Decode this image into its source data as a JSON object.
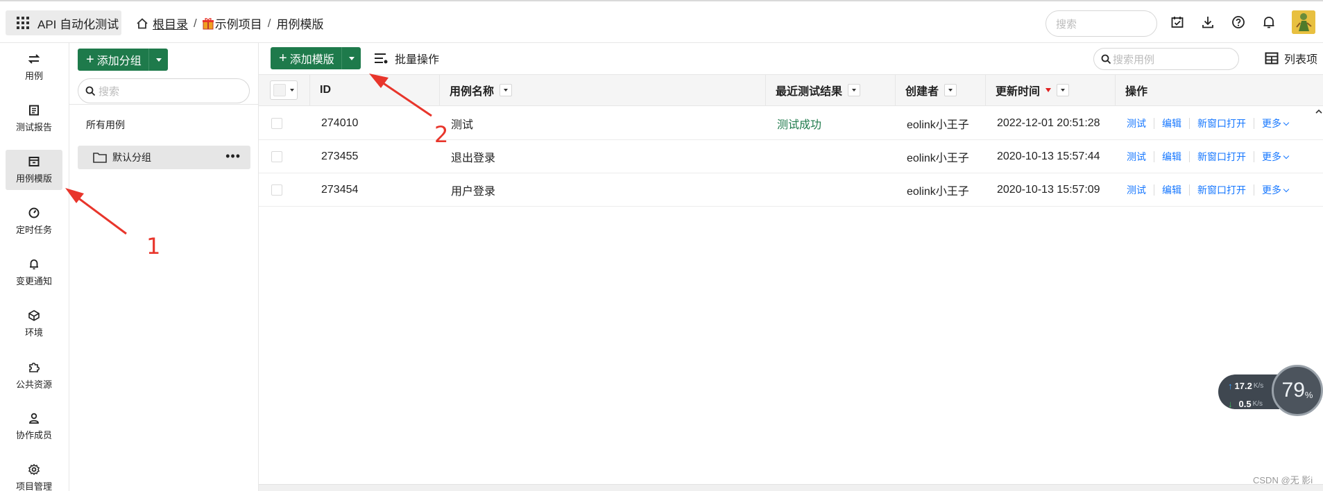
{
  "topbar": {
    "app_name": "API 自动化测试",
    "breadcrumb": {
      "root": "根目录",
      "sep": "/",
      "project": "示例项目",
      "current": "用例模版"
    },
    "search_placeholder": "搜索"
  },
  "rail": {
    "items": [
      {
        "label": "用例",
        "icon": "swap-icon"
      },
      {
        "label": "测试报告",
        "icon": "report-icon"
      },
      {
        "label": "用例模版",
        "icon": "template-icon",
        "active": true
      },
      {
        "label": "定时任务",
        "icon": "timer-icon"
      },
      {
        "label": "变更通知",
        "icon": "bell-icon"
      },
      {
        "label": "环境",
        "icon": "cube-icon"
      },
      {
        "label": "公共资源",
        "icon": "puzzle-icon"
      },
      {
        "label": "协作成员",
        "icon": "user-icon"
      },
      {
        "label": "项目管理",
        "icon": "gear-icon"
      }
    ]
  },
  "group_panel": {
    "add_group_label": "添加分组",
    "search_placeholder": "搜索",
    "all_cases": "所有用例",
    "default_group": "默认分组",
    "more": "•••"
  },
  "toolbar": {
    "add_template_label": "添加模版",
    "batch_label": "批量操作",
    "search_placeholder": "搜索用例",
    "columns_label": "列表项"
  },
  "table": {
    "headers": {
      "id": "ID",
      "name": "用例名称",
      "result": "最近测试结果",
      "creator": "创建者",
      "updated": "更新时间",
      "actions": "操作"
    },
    "actions": {
      "test": "测试",
      "edit": "编辑",
      "new_window": "新窗口打开",
      "more": "更多"
    },
    "rows": [
      {
        "id": "274010",
        "name": "测试",
        "result": "测试成功",
        "creator": "eolink小王子",
        "updated": "2022-12-01 20:51:28"
      },
      {
        "id": "273455",
        "name": "退出登录",
        "result": "",
        "creator": "eolink小王子",
        "updated": "2020-10-13 15:57:44"
      },
      {
        "id": "273454",
        "name": "用户登录",
        "result": "",
        "creator": "eolink小王子",
        "updated": "2020-10-13 15:57:09"
      }
    ]
  },
  "annotations": {
    "one": "1",
    "two": "2",
    "color": "#e8352b"
  },
  "net_widget": {
    "up": "17.2",
    "down": "0.5",
    "unit": "K/s",
    "percent": "79",
    "percent_sign": "%"
  },
  "watermark": "CSDN @无 影i",
  "colors": {
    "brand_green": "#1e7a4b",
    "link_blue": "#1677ff",
    "success": "#1e7a4b"
  }
}
